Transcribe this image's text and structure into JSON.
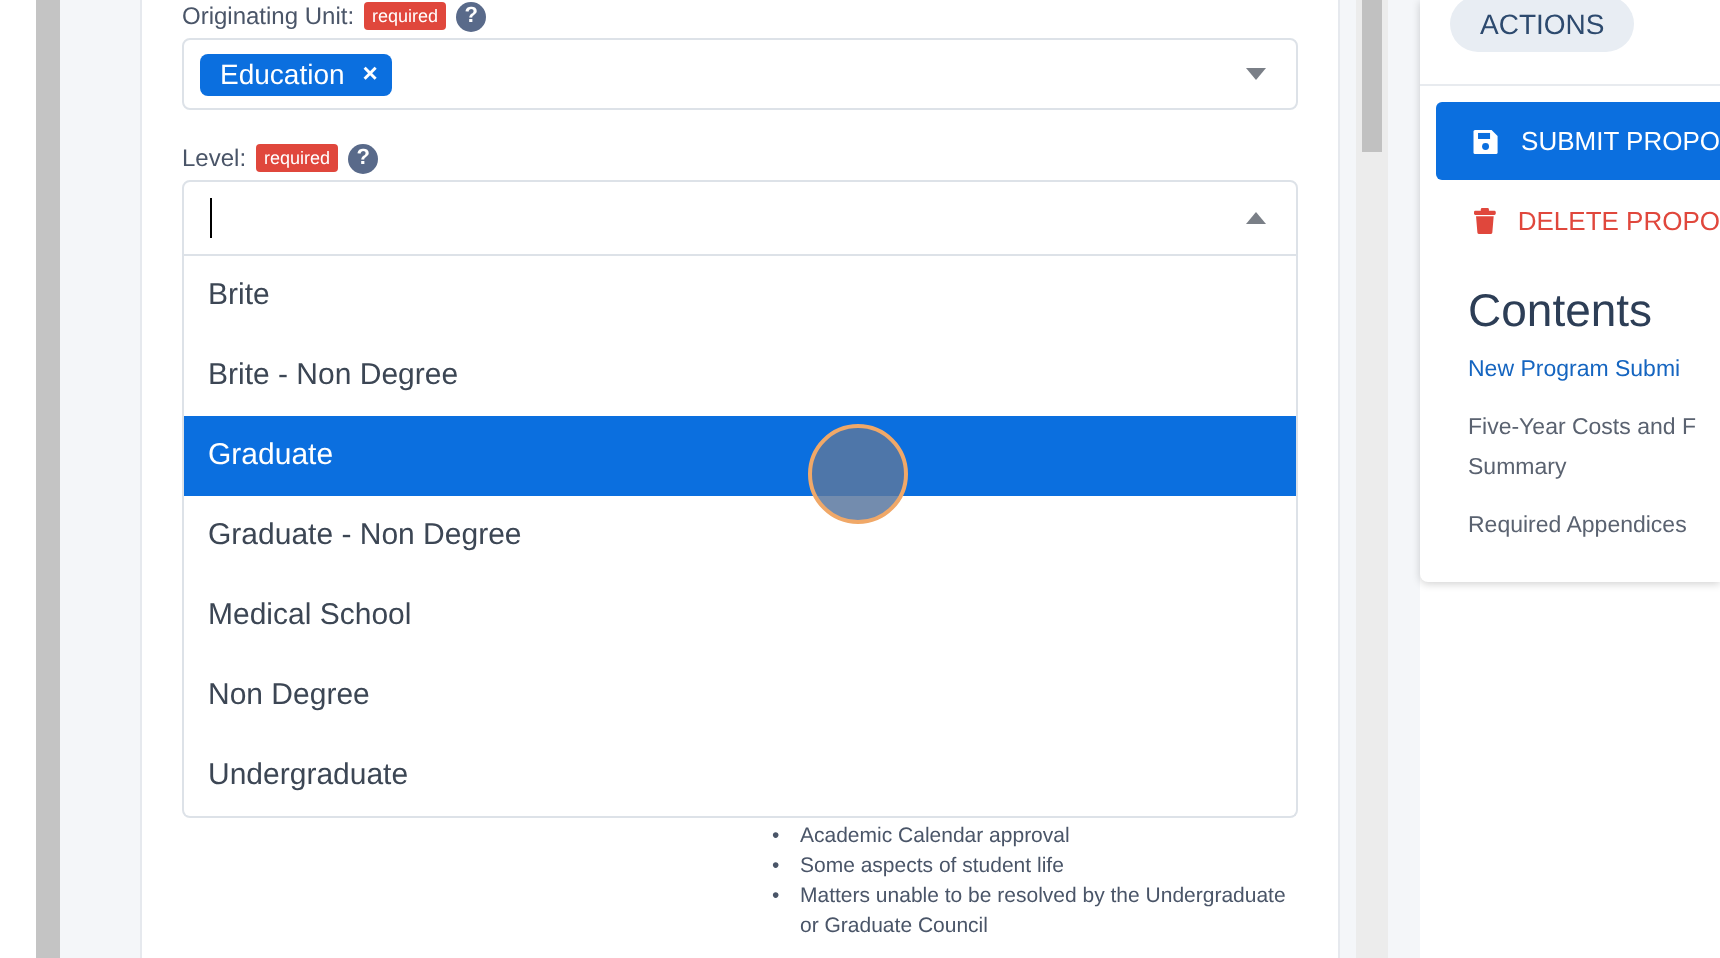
{
  "originating_unit": {
    "label": "Originating Unit:",
    "badge": "required",
    "help": "?",
    "tags": [
      {
        "label": "Education",
        "remove": "×"
      }
    ],
    "expanded": false
  },
  "level": {
    "label": "Level:",
    "badge": "required",
    "help": "?",
    "expanded": true,
    "options": [
      {
        "label": "Brite",
        "selected": false
      },
      {
        "label": "Brite - Non Degree",
        "selected": false
      },
      {
        "label": "Graduate",
        "selected": true
      },
      {
        "label": "Graduate - Non Degree",
        "selected": false
      },
      {
        "label": "Medical School",
        "selected": false
      },
      {
        "label": "Non Degree",
        "selected": false
      },
      {
        "label": "Undergraduate",
        "selected": false
      }
    ]
  },
  "notes": [
    {
      "marker": "•",
      "text": "Academic Calendar approval"
    },
    {
      "marker": "•",
      "text": "Some aspects of student life"
    },
    {
      "marker": "•",
      "text": "Matters unable to be resolved by the Undergraduate"
    },
    {
      "text": "or Graduate Council"
    }
  ],
  "sidebar": {
    "tab": "ACTIONS",
    "buttons": [
      {
        "kind": "primary",
        "label": "SUBMIT PROPO"
      },
      {
        "kind": "danger",
        "label": "DELETE PROPO"
      }
    ],
    "contents_title": "Contents",
    "contents": [
      {
        "kind": "link",
        "label": "New Program Submi"
      },
      {
        "kind": "text",
        "label": "Five-Year Costs and F\nSummary"
      },
      {
        "kind": "text",
        "label": "Required Appendices"
      }
    ]
  }
}
